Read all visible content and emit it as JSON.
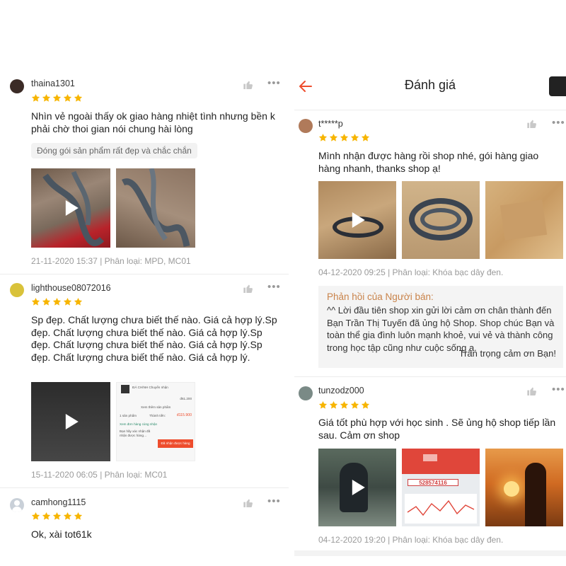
{
  "colors": {
    "accent": "#ee4d2d",
    "star": "#f7b500",
    "seller_title": "#c9834a",
    "meta": "#9a9a9a"
  },
  "left": {
    "reviews": [
      {
        "username": "thaina1301",
        "stars": 5,
        "text": "Nhìn vẻ ngoài thấy ok giao hàng nhiệt tình nhưng bền k phải chờ thoi gian nói chung hài lòng",
        "tag": "Đóng gói sản phẩm rất đẹp và chắc chắn",
        "meta": "21-11-2020 15:37 | Phân loại: MPD, MC01",
        "media": [
          "video-thumbnail",
          "photo-thumbnail"
        ],
        "like_icon": "thumbs-up-icon",
        "more_icon": "more-dots-icon"
      },
      {
        "username": "lighthouse08072016",
        "stars": 5,
        "text": "Sp đẹp. Chất lượng chưa biết thế nào. Giá cả hợp lý.Sp đẹp. Chất lượng chưa biết thế nào. Giá cả hợp lý.Sp đẹp. Chất lượng chưa biết thế nào. Giá cả hợp lý.Sp đẹp. Chất lượng chưa biết thế nào. Giá cả hợp lý.",
        "meta": "15-11-2020 06:05 | Phân loại: MC01",
        "media": [
          "video-thumbnail",
          "screenshot-thumbnail"
        ],
        "screenshot_texts": {
          "s1": "ĐÁ CHÍNH Chuyển nhận",
          "price1": "đ61.200",
          "s2": "Xem thêm sản phẩm",
          "s3": "1 sản phẩm",
          "s4": "Thành tiền:",
          "price2": "đ115.900",
          "s5": "Xem đơn hàng cùng nhận",
          "s6": "Bạn hãy xác nhận đã nhận được hàng…",
          "s7": "Đã nhận được hàng"
        },
        "like_icon": "thumbs-up-icon",
        "more_icon": "more-dots-icon"
      },
      {
        "username": "camhong1115",
        "stars": 5,
        "text": "Ok, xài tot61k",
        "like_icon": "thumbs-up-icon",
        "more_icon": "more-dots-icon"
      }
    ]
  },
  "right": {
    "header": {
      "title": "Đánh giá",
      "back_icon": "back-arrow-icon",
      "cart_icon": "cart-icon"
    },
    "reviews": [
      {
        "username": "t*****p",
        "stars": 5,
        "text": "Mình nhận được hàng rồi shop nhé, gói hàng giao hàng nhanh, thanks shop ạ!",
        "meta": "04-12-2020 09:25 | Phân loại: Khóa bạc dây đen.",
        "media": [
          "video-thumbnail",
          "photo-thumbnail",
          "photo-thumbnail"
        ],
        "seller_reply": {
          "title": "Phản hồi của Người bán:",
          "body": "^^ Lời đầu tiên shop xin gửi lời cảm ơn chân thành đến Bạn Trần Thị Tuyến đã ủng hộ Shop. Shop chúc Bạn và toàn thể gia đình luôn mạnh khoẻ, vui vẻ và thành công trong học tập cũng như cuộc sống ạ.",
          "sign": "Trân trọng cảm ơn Bạn!"
        },
        "like_icon": "thumbs-up-icon",
        "more_icon": "more-dots-icon"
      },
      {
        "username": "tunzodz000",
        "stars": 5,
        "text": "Giá tốt phù hợp với học sinh . Sẽ ủng hộ shop tiếp lần sau. Cảm ơn shop",
        "meta": "04-12-2020 19:20 | Phân loại: Khóa bạc dây đen.",
        "media": [
          "video-thumbnail",
          "screenshot-thumbnail",
          "photo-thumbnail"
        ],
        "screen_number": "528574116",
        "like_icon": "thumbs-up-icon",
        "more_icon": "more-dots-icon"
      }
    ]
  }
}
